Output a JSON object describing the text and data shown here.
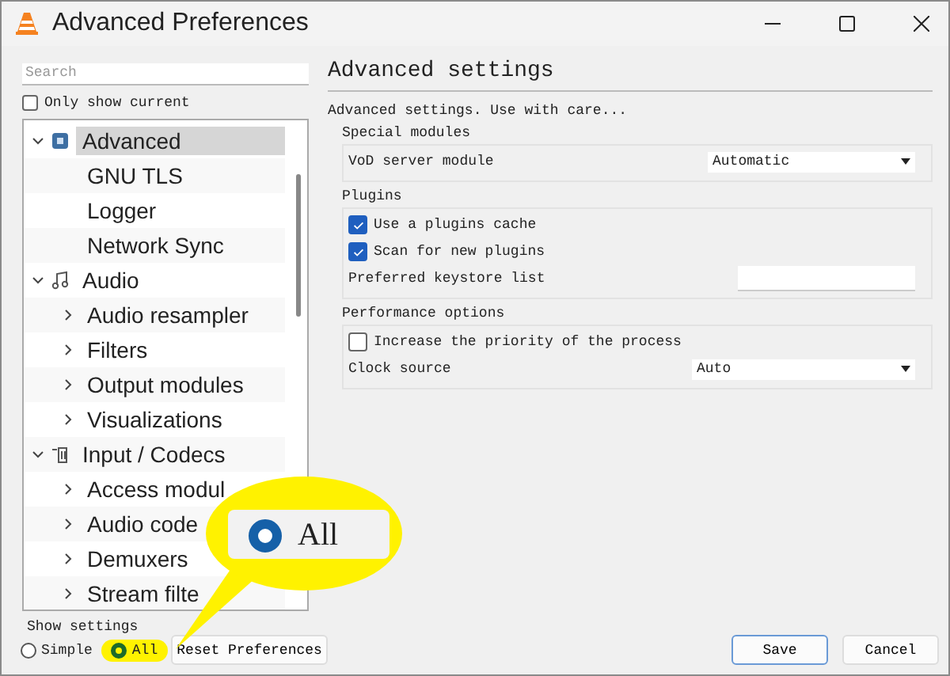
{
  "window": {
    "title": "Advanced Preferences"
  },
  "search": {
    "placeholder": "Search"
  },
  "only_show_current": {
    "label": "Only show current",
    "checked": false
  },
  "tree": [
    {
      "label": "Advanced",
      "expanded": true,
      "selected": true,
      "children": [
        {
          "label": "GNU TLS",
          "selected": false
        },
        {
          "label": "Logger",
          "selected": false
        },
        {
          "label": "Network Sync",
          "selected": false
        }
      ]
    },
    {
      "label": "Audio",
      "expanded": true,
      "selected": false,
      "children": [
        {
          "label": "Audio resampler",
          "expanded": false,
          "selected": false
        },
        {
          "label": "Filters",
          "expanded": false,
          "selected": false
        },
        {
          "label": "Output modules",
          "expanded": false,
          "selected": false
        },
        {
          "label": "Visualizations",
          "expanded": false,
          "selected": false
        }
      ]
    },
    {
      "label": "Input / Codecs",
      "expanded": true,
      "selected": false,
      "children": [
        {
          "label": "Access modul",
          "expanded": false,
          "selected": false
        },
        {
          "label": "Audio code",
          "expanded": false,
          "selected": false
        },
        {
          "label": "Demuxers",
          "expanded": false,
          "selected": false
        },
        {
          "label": "Stream filte",
          "expanded": false,
          "selected": false
        }
      ]
    }
  ],
  "show_settings": {
    "label": "Show settings",
    "options": [
      {
        "label": "Simple",
        "selected": false,
        "highlighted": false
      },
      {
        "label": "All",
        "selected": true,
        "highlighted": true
      }
    ]
  },
  "reset_button": "Reset Preferences",
  "callout": {
    "label": "All",
    "selected": true
  },
  "panel": {
    "title": "Advanced settings",
    "description": "Advanced settings. Use with care...",
    "groups": [
      {
        "title": "Special modules",
        "rows": [
          {
            "kind": "dropdown",
            "label": "VoD server module",
            "value": "Automatic"
          }
        ]
      },
      {
        "title": "Plugins",
        "rows": [
          {
            "kind": "checkbox",
            "label": "Use a plugins cache",
            "checked": true
          },
          {
            "kind": "checkbox",
            "label": "Scan for new plugins",
            "checked": true
          },
          {
            "kind": "text",
            "label": "Preferred keystore list"
          }
        ]
      },
      {
        "title": "Performance options",
        "rows": [
          {
            "kind": "checkbox",
            "label": "Increase the priority of the process",
            "checked": false
          },
          {
            "kind": "dropdown",
            "label": "Clock source",
            "value": "Auto"
          }
        ]
      }
    ]
  },
  "buttons": [
    {
      "label": "Save",
      "default": true
    },
    {
      "label": "Cancel",
      "default": false
    }
  ]
}
